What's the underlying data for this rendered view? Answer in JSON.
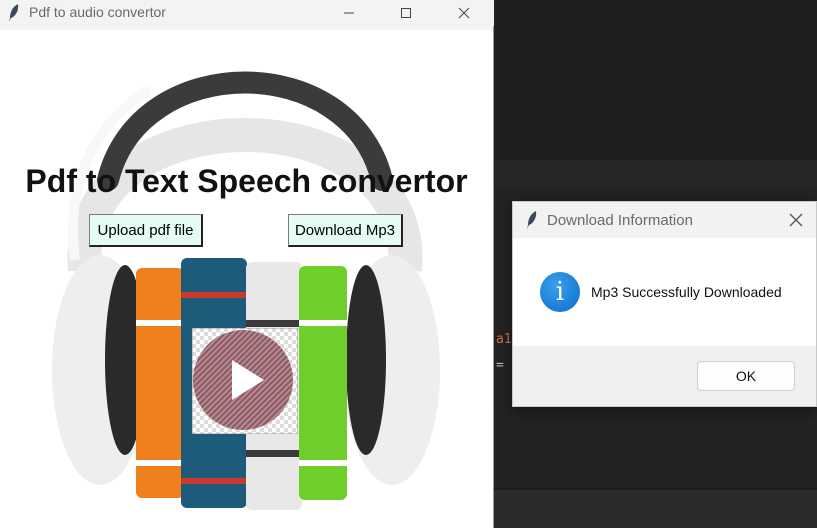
{
  "main_window": {
    "title": "Pdf to audio convertor",
    "heading": "Pdf to Text Speech convertor",
    "upload_label": "Upload pdf file",
    "download_label": "Download Mp3"
  },
  "dialog": {
    "title": "Download Information",
    "message": "Mp3 Successfully Downloaded",
    "ok_label": "OK",
    "icon": "info-icon"
  },
  "editor": {
    "code_line_1": "a1",
    "code_line_2": "= '"
  },
  "colors": {
    "button_bg": "#e6fbf4",
    "info_blue": "#0b6cc9",
    "editor_bg": "#1f1f1f"
  }
}
